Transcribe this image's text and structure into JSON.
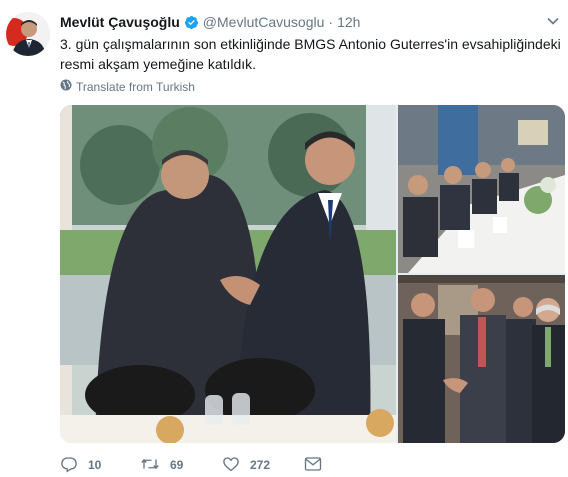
{
  "tweet": {
    "author_name": "Mevlüt Çavuşoğlu",
    "handle": "@MevlutCavusoglu",
    "separator": "·",
    "time": "12h",
    "text": "3. gün çalışmalarının son etkinliğinde BMGS Antonio Guterres'in evsahipliğindeki resmi akşam yemeğine katıldık.",
    "translate_label": "Translate from Turkish"
  },
  "actions": {
    "replies": "10",
    "retweets": "69",
    "likes": "272"
  },
  "colors": {
    "verified": "#1da1f2",
    "secondary_text": "#657786",
    "primary_text": "#14171a"
  }
}
